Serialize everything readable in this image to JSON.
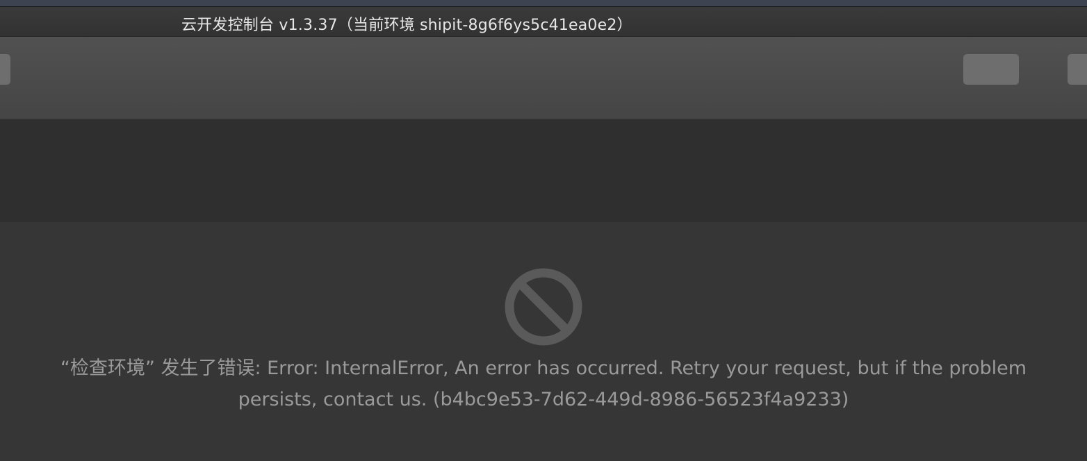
{
  "window": {
    "title": "云开发控制台 v1.3.37（当前环境 shipit-8g6f6ys5c41ea0e2）"
  },
  "error": {
    "icon": "prohibited-icon",
    "line1": "“检查环境” 发生了错误: Error: InternalError, An error has occurred. Retry your request, but if the problem",
    "line2": "persists, contact us. (b4bc9e53-7d62-449d-8986-56523f4a9233)"
  },
  "colors": {
    "background": "#363636",
    "titlebar": "#353535",
    "toolbar": "#4c4c4c",
    "header_band": "#2f2f2f",
    "error_text": "#9a9a9a",
    "icon": "#5a5a5a"
  }
}
